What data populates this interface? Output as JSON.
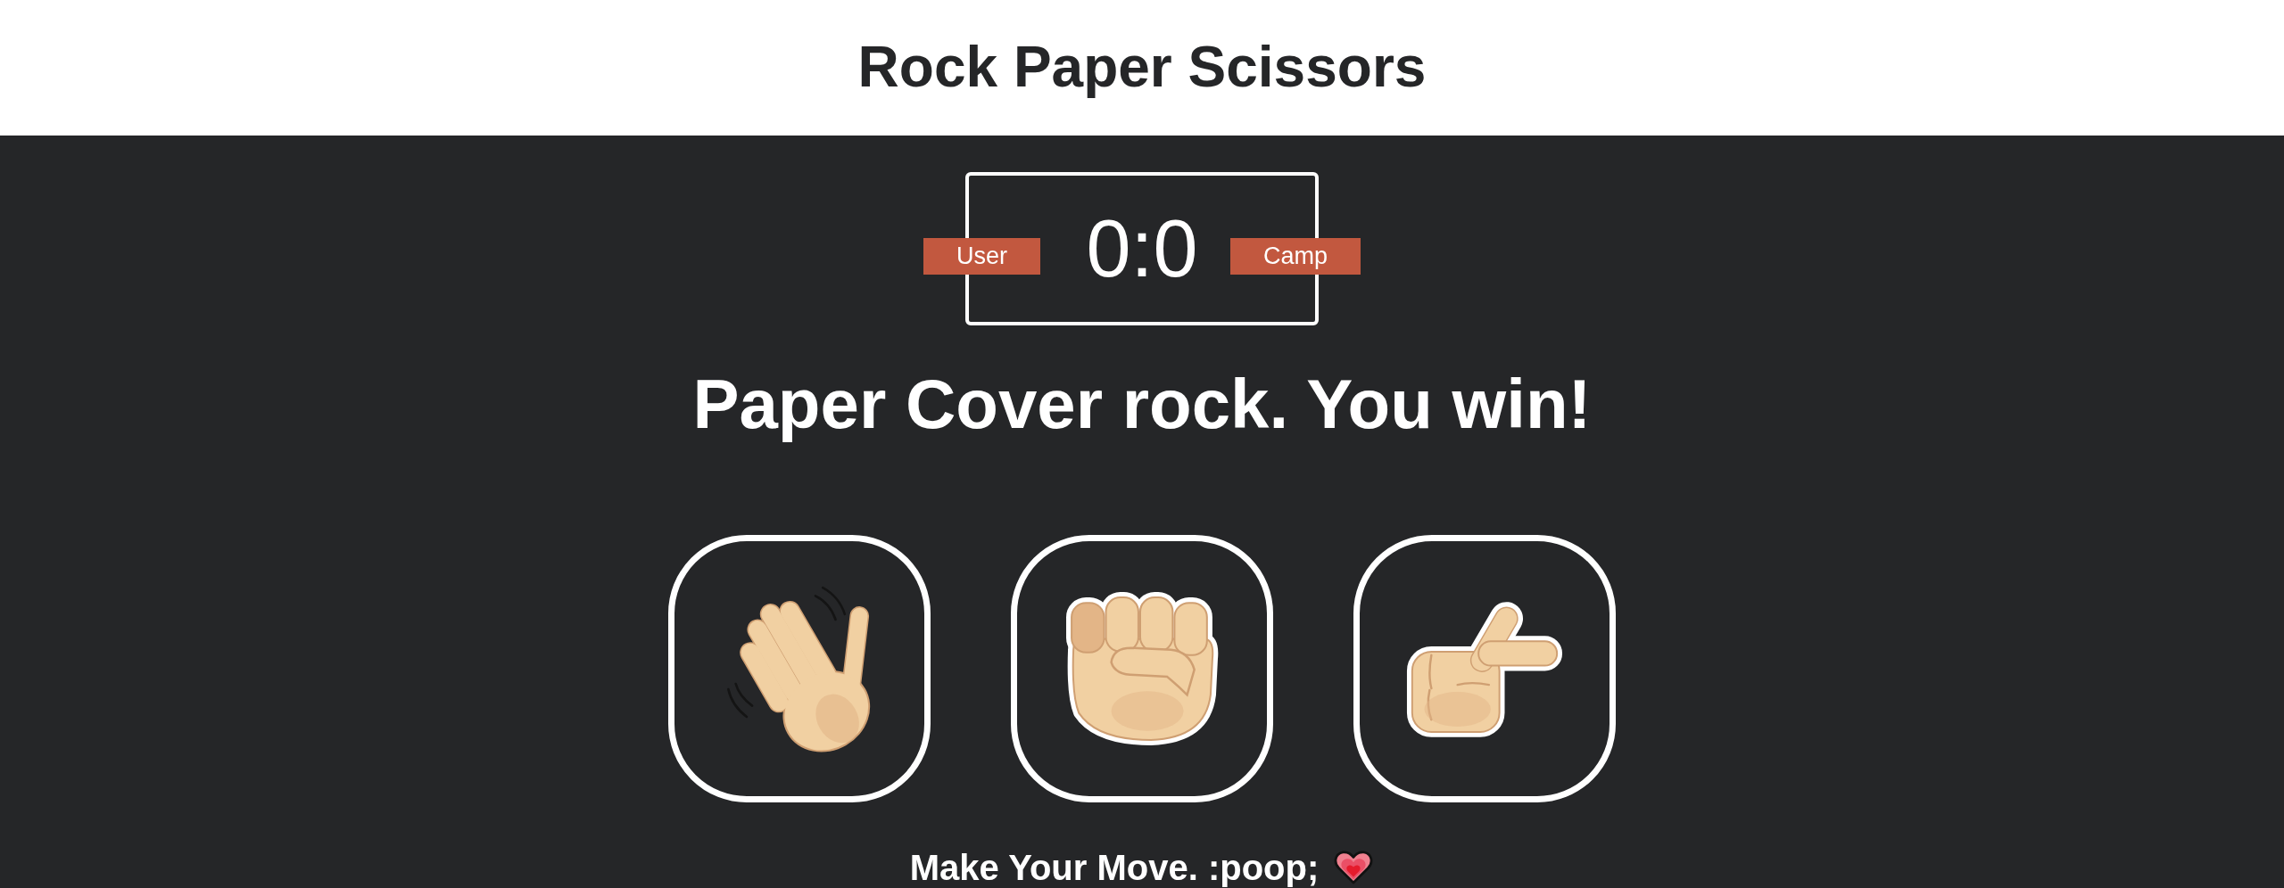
{
  "header": {
    "title": "Rock Paper Scissors"
  },
  "scoreboard": {
    "user_label": "User",
    "score": "0:0",
    "computer_label": "Camp"
  },
  "result": {
    "message": "Paper Cover rock. You win!"
  },
  "choices": [
    {
      "kind": "wave"
    },
    {
      "kind": "fist"
    },
    {
      "kind": "point"
    }
  ],
  "prompt": {
    "text": "Make Your Move. :poop;"
  }
}
